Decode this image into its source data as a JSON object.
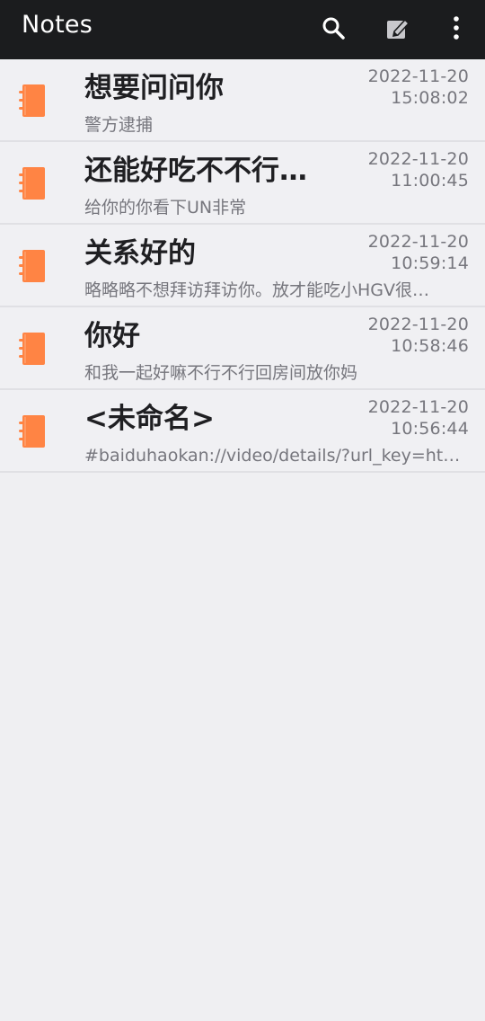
{
  "toolbar": {
    "title": "Notes",
    "search_icon": "search-icon",
    "compose_icon": "compose-note-icon",
    "more_icon": "more-options-icon"
  },
  "colors": {
    "toolbar_background": "#1b1c1e",
    "toolbar_text": "#ffffff",
    "app_background": "#efeff2",
    "note_icon": "#ff8444",
    "title_text": "#1f1f22",
    "secondary_text": "#76767d"
  },
  "notes": [
    {
      "title": "想要问问你",
      "preview": "警方逮捕",
      "date": "2022-11-20",
      "time": "15:08:02",
      "icon": "notebook-icon"
    },
    {
      "title": "还能好吃不不行…",
      "preview": "给你的你看下UN非常",
      "date": "2022-11-20",
      "time": "11:00:45",
      "icon": "notebook-icon"
    },
    {
      "title": "关系好的",
      "preview": "略略略不想拜访拜访你。放才能吃小HGV很…",
      "date": "2022-11-20",
      "time": "10:59:14",
      "icon": "notebook-icon"
    },
    {
      "title": "你好",
      "preview": "和我一起好嘛不行不行回房间放你妈",
      "date": "2022-11-20",
      "time": "10:58:46",
      "icon": "notebook-icon"
    },
    {
      "title": "<未命名>",
      "preview": "#baiduhaokan://video/details/?url_key=http…",
      "date": "2022-11-20",
      "time": "10:56:44",
      "icon": "notebook-icon"
    }
  ]
}
